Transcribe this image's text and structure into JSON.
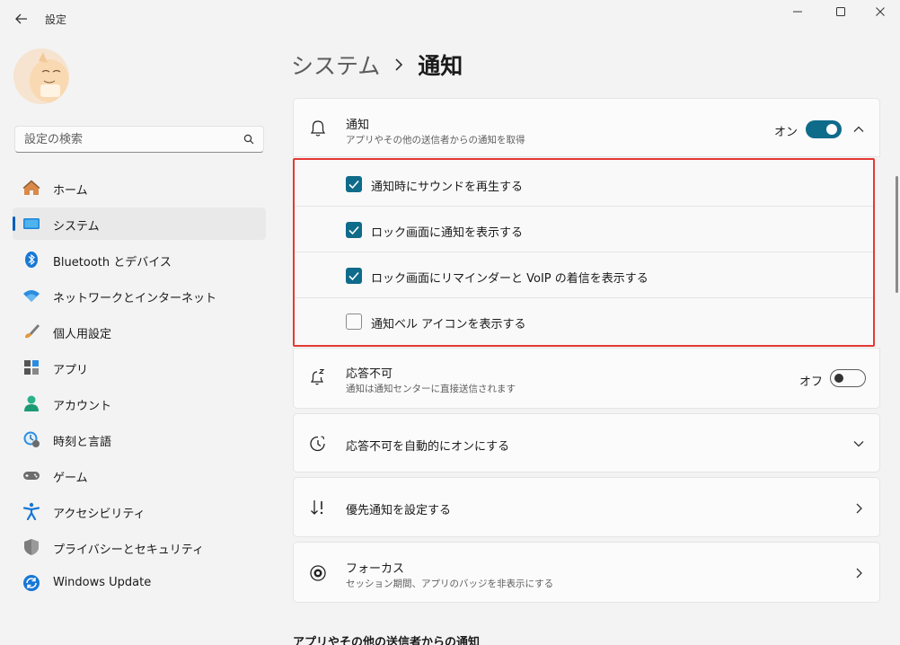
{
  "window": {
    "title": "設定"
  },
  "search": {
    "placeholder": "設定の検索"
  },
  "sidebar": {
    "items": [
      {
        "label": "ホーム",
        "icon": "home-icon"
      },
      {
        "label": "システム",
        "icon": "system-icon",
        "active": true
      },
      {
        "label": "Bluetooth とデバイス",
        "icon": "bluetooth-icon"
      },
      {
        "label": "ネットワークとインターネット",
        "icon": "wifi-icon"
      },
      {
        "label": "個人用設定",
        "icon": "brush-icon"
      },
      {
        "label": "アプリ",
        "icon": "apps-icon"
      },
      {
        "label": "アカウント",
        "icon": "account-icon"
      },
      {
        "label": "時刻と言語",
        "icon": "time-language-icon"
      },
      {
        "label": "ゲーム",
        "icon": "gamepad-icon"
      },
      {
        "label": "アクセシビリティ",
        "icon": "accessibility-icon"
      },
      {
        "label": "プライバシーとセキュリティ",
        "icon": "shield-icon"
      },
      {
        "label": "Windows Update",
        "icon": "windows-update-icon"
      }
    ]
  },
  "breadcrumb": {
    "parent": "システム",
    "current": "通知"
  },
  "notifications": {
    "title": "通知",
    "subtitle": "アプリやその他の送信者からの通知を取得",
    "toggle_label": "オン",
    "toggle_state": "on",
    "options": [
      {
        "label": "通知時にサウンドを再生する",
        "checked": true
      },
      {
        "label": "ロック画面に通知を表示する",
        "checked": true
      },
      {
        "label": "ロック画面にリマインダーと VoIP の着信を表示する",
        "checked": true
      },
      {
        "label": "通知ベル アイコンを表示する",
        "checked": false
      }
    ]
  },
  "do_not_disturb": {
    "title": "応答不可",
    "subtitle": "通知は通知センターに直接送信されます",
    "toggle_label": "オフ",
    "toggle_state": "off"
  },
  "auto_dnd": {
    "title": "応答不可を自動的にオンにする"
  },
  "priority": {
    "title": "優先通知を設定する"
  },
  "focus": {
    "title": "フォーカス",
    "subtitle": "セッション期間、アプリのバッジを非表示にする"
  },
  "section": {
    "apps_title": "アプリやその他の送信者からの通知"
  },
  "colors": {
    "accent": "#0f6b8a",
    "highlight_border": "#e53935",
    "nav_indicator": "#005fb8"
  }
}
